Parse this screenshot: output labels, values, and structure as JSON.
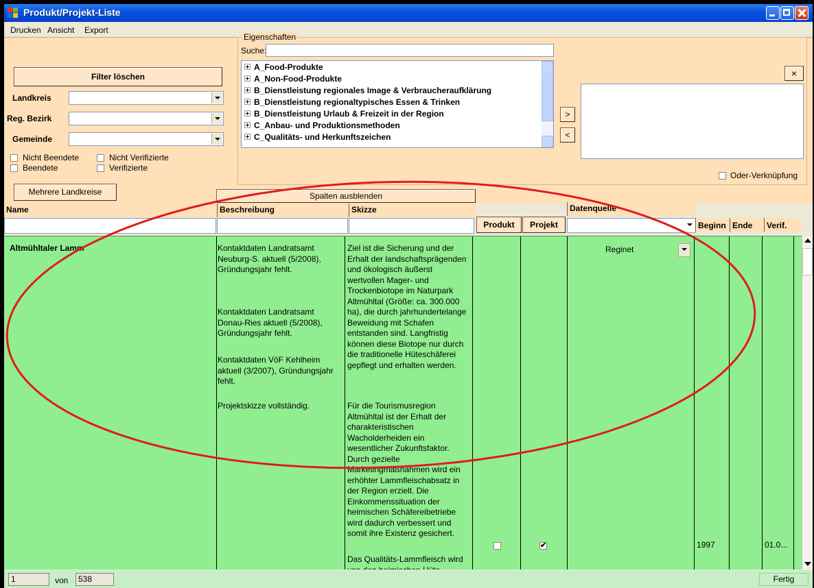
{
  "window": {
    "title": "Produkt/Projekt-Liste"
  },
  "menu": [
    "Drucken",
    "Ansicht",
    "Export"
  ],
  "filter": {
    "clear_button": "Filter löschen",
    "landkreis_label": "Landkreis",
    "regbezirk_label": "Reg. Bezirk",
    "gemeinde_label": "Gemeinde",
    "checkboxes": [
      {
        "label": "Nicht Beendete",
        "checked": false
      },
      {
        "label": "Nicht Verifizierte",
        "checked": false
      },
      {
        "label": "Beendete",
        "checked": false
      },
      {
        "label": "Verifizierte",
        "checked": false
      }
    ],
    "multi_landkreise_button": "Mehrere Landkreise"
  },
  "properties": {
    "group_title": "Eigenschaften",
    "search_label": "Suche:",
    "search_value": "",
    "tree_items": [
      "A_Food-Produkte",
      "A_Non-Food-Produkte",
      "B_Dienstleistung regionales Image & Verbraucheraufklärung",
      "B_Dienstleistung regionaltypisches Essen & Trinken",
      "B_Dienstleistung Urlaub & Freizeit in der Region",
      "C_Anbau- und Produktionsmethoden",
      "C_Qualitäts- und Herkunftszeichen"
    ],
    "add_button": ">",
    "remove_button": "<",
    "clear_x_button": "×",
    "or_link_label": "Oder-Verknüpfung"
  },
  "columns_button": "Spalten ausblenden",
  "headers": {
    "name": "Name",
    "beschreibung": "Beschreibung",
    "skizze": "Skizze",
    "produkt": "Produkt",
    "projekt": "Projekt",
    "datenquelle": "Datenquelle",
    "beginn": "Beginn",
    "ende": "Ende",
    "verif": "Verif."
  },
  "row": {
    "name": "Altmühltaler Lamm",
    "beschreibung_1": "Kontaktdaten Landratsamt Neuburg-S. aktuell (5/2008), Gründungsjahr fehlt.",
    "beschreibung_2": "Kontaktdaten Landratsamt Donau-Ries aktuell (5/2008), Gründungsjahr fehlt.",
    "beschreibung_3": "Kontaktdaten VöF Kehlheim aktuell (3/2007), Gründungsjahr fehlt.",
    "beschreibung_4": "Projektskizze vollständig.",
    "skizze_1": "Ziel ist die Sicherung und der Erhalt der landschaftsprägenden und ökologisch äußerst wertvollen Mager- und Trockenbiotope im Naturpark Altmühltal (Größe: ca. 300.000 ha), die durch jahrhundertelange Beweidung mit Schafen entstanden sind. Langfristig können diese Biotope nur durch die traditionelle Hüteschäferei gepflegt und erhalten werden.",
    "skizze_2": "Für die Tourismusregion Altmühltal ist der Erhalt der charakteristischen Wacholderheiden ein wesentlicher Zukunftsfaktor. Durch gezielte Marketingmaßnahmen wird ein erhöhter Lammfleischabsatz in der Region erzielt. Die Einkommenssituation der heimischen Schäfereibetriebe wird dadurch verbessert und somit ihre Existenz gesichert.",
    "skizze_3": "Das Qualitäts-Lammfleisch wird von den heimischen Hüte",
    "produkt": false,
    "projekt": true,
    "datenquelle": "Reginet",
    "beginn": "1997",
    "ende": "",
    "verif": "01.0..."
  },
  "status": {
    "current": "1",
    "von_label": "von",
    "total": "538",
    "state": "Fertig"
  }
}
